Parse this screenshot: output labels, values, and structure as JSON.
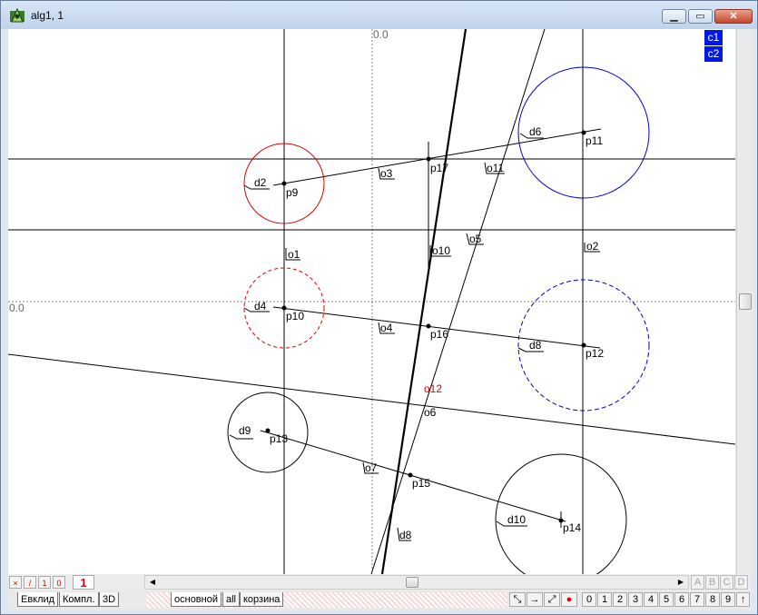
{
  "window": {
    "title": "alg1, 1"
  },
  "axes": {
    "x_origin_label": "0.0",
    "y_origin_label": "0.0"
  },
  "layers": [
    "c1",
    "c2"
  ],
  "labels": {
    "p9": "p9",
    "p10": "p10",
    "p11": "p11",
    "p12": "p12",
    "p13": "p13",
    "p14": "p14",
    "p15": "p15",
    "p16": "p16",
    "p17": "p17",
    "d2": "d2",
    "d4": "d4",
    "d6": "d6",
    "d8": "d8",
    "d9": "d9",
    "d10": "d10",
    "dd8": "d8",
    "o1": "o1",
    "o2": "o2",
    "o3": "o3",
    "o4": "o4",
    "o5": "o5",
    "o7": "o7",
    "o10": "o10",
    "o11": "o11",
    "o12": "o12",
    "o13": "o6"
  },
  "colors": {
    "red": "#e00000",
    "blue": "#0000d0",
    "black": "#000000",
    "grid": "#808080"
  },
  "bottom": {
    "mode_buttons": [
      "×",
      "/",
      "1",
      "0"
    ],
    "counter": "1",
    "abc": [
      "A",
      "B",
      "C",
      "D"
    ],
    "tabs_left": [
      "Евклид",
      "Компл.",
      "3D"
    ],
    "tabs_mid": [
      "основной",
      "all",
      "корзина"
    ],
    "digits": [
      "0",
      "1",
      "2",
      "3",
      "4",
      "5",
      "6",
      "7",
      "8",
      "9",
      "↑"
    ]
  }
}
